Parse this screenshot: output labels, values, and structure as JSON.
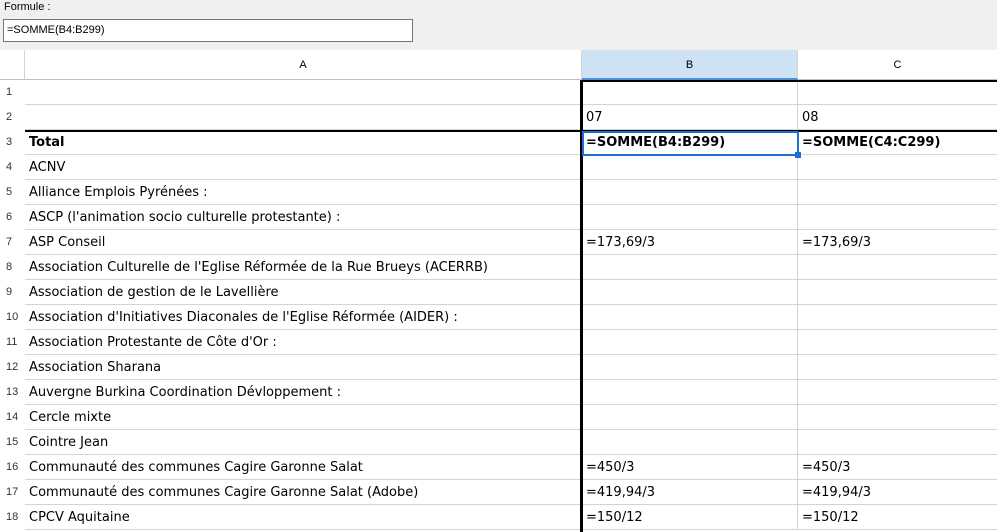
{
  "formula": {
    "label": "Formule :",
    "value": "=SOMME(B4:B299)"
  },
  "columns": {
    "a": "A",
    "b": "B",
    "c": "C"
  },
  "rows": [
    {
      "n": "1",
      "a": "",
      "b": "",
      "c": ""
    },
    {
      "n": "2",
      "a": "",
      "b": "07",
      "c": "08"
    },
    {
      "n": "3",
      "a": "Total",
      "b": "=SOMME(B4:B299)",
      "c": "=SOMME(C4:C299)"
    },
    {
      "n": "4",
      "a": "ACNV",
      "b": "",
      "c": ""
    },
    {
      "n": "5",
      "a": "Alliance Emplois Pyrénées :",
      "b": "",
      "c": ""
    },
    {
      "n": "6",
      "a": "ASCP (l'animation socio culturelle protestante) :",
      "b": "",
      "c": ""
    },
    {
      "n": "7",
      "a": "ASP Conseil",
      "b": "=173,69/3",
      "c": "=173,69/3"
    },
    {
      "n": "8",
      "a": "Association Culturelle de l'Eglise Réformée de la Rue Brueys (ACERRB)",
      "b": "",
      "c": ""
    },
    {
      "n": "9",
      "a": "Association de gestion de le Lavellière",
      "b": "",
      "c": ""
    },
    {
      "n": "10",
      "a": "Association d'Initiatives Diaconales de l'Eglise Réformée (AIDER) :",
      "b": "",
      "c": ""
    },
    {
      "n": "11",
      "a": "Association Protestante de Côte d'Or :",
      "b": "",
      "c": ""
    },
    {
      "n": "12",
      "a": "Association Sharana",
      "b": "",
      "c": ""
    },
    {
      "n": "13",
      "a": "Auvergne Burkina Coordination Dévloppement :",
      "b": "",
      "c": ""
    },
    {
      "n": "14",
      "a": "Cercle mixte",
      "b": "",
      "c": ""
    },
    {
      "n": "15",
      "a": "Cointre Jean",
      "b": "",
      "c": ""
    },
    {
      "n": "16",
      "a": "Communauté des communes Cagire Garonne Salat",
      "b": "=450/3",
      "c": "=450/3"
    },
    {
      "n": "17",
      "a": "Communauté des communes Cagire Garonne Salat (Adobe)",
      "b": "=419,94/3",
      "c": "=419,94/3"
    },
    {
      "n": "18",
      "a": "CPCV Aquitaine",
      "b": "=150/12",
      "c": "=150/12"
    }
  ]
}
